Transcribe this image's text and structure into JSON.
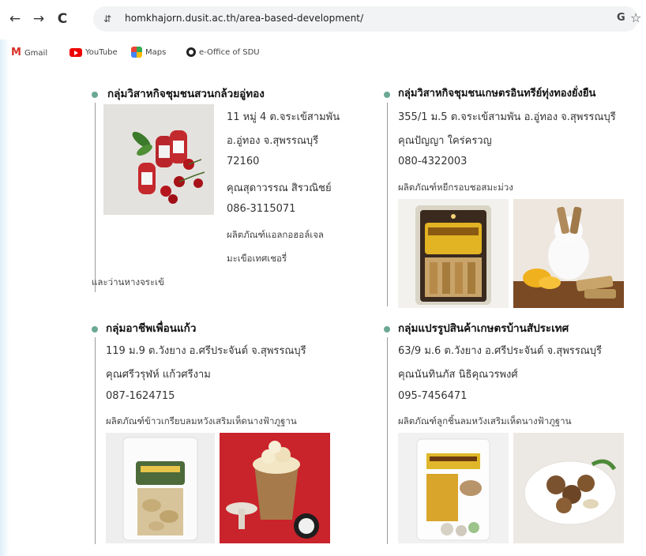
{
  "browser": {
    "back_icon": "←",
    "forward_icon": "→",
    "reload_icon": "C",
    "site_info_icon": "⇵",
    "url": "homkhajorn.dusit.ac.th/area-based-development/",
    "google_icon": "G",
    "star_icon": "☆"
  },
  "bookmarks": [
    {
      "label": "Gmail",
      "icon": "gmail-icon"
    },
    {
      "label": "YouTube",
      "icon": "youtube-icon"
    },
    {
      "label": "Maps",
      "icon": "maps-icon"
    },
    {
      "label": "e-Office of SDU",
      "icon": "eoffice-icon"
    }
  ],
  "groups": [
    {
      "title": "กลุ่มวิสาหกิจชุมชนสวนกล้วยอู่ทอง",
      "lines": [
        "11 หมู่ 4 ต.จระเข้สามพัน",
        "อ.อู่ทอง จ.สุพรรณบุรี",
        "72160",
        "คุณสุดาวรรณ สิรวณิชย์",
        "086-3115071",
        "ผลิตภัณฑ์แอลกอฮอล์เจล",
        "มะเขือเทศเชอรี่",
        "และว่านหางจระเข้"
      ]
    },
    {
      "title": "กลุ่มวิสาหกิจชุมชนเกษตรอินทรีย์ทุ่งทองยั่งยืน",
      "lines": [
        "355/1 ม.5 ต.จระเข้สามพัน อ.อู่ทอง จ.สุพรรณบุรี",
        "คุณปัญญา ใคร่ครวญ",
        "080-4322003",
        "ผลิตภัณฑ์หยีกรอบชอสมะม่วง"
      ]
    },
    {
      "title": "กลุ่มอาชีพเพื่อนแก้ว",
      "lines": [
        "119 ม.9 ต.วังยาง อ.ศรีประจันต์ จ.สุพรรณบุรี",
        "คุณศรีวรุฬห์ แก้วศรีงาม",
        "087-1624715",
        "ผลิตภัณฑ์ข้าวเกรียบลมหวังเสริมเห็ดนางฟ้าภูฐาน"
      ]
    },
    {
      "title": "กลุ่มแปรรูปสินค้าเกษตรบ้านสัประเทศ",
      "lines": [
        "63/9 ม.6 ต.วังยาง อ.ศรีประจันต์ จ.สุพรรณบุรี",
        "คุณนันทินภัส นิธิคุณวรพงศ์",
        "095-7456471",
        "ผลิตภัณฑ์ลูกชิ้นลมหวังเสริมเห็ดนางฟ้าภูฐาน"
      ]
    }
  ],
  "colors": {
    "bullet": "#6aa993",
    "divider": "#9a9a9a"
  }
}
